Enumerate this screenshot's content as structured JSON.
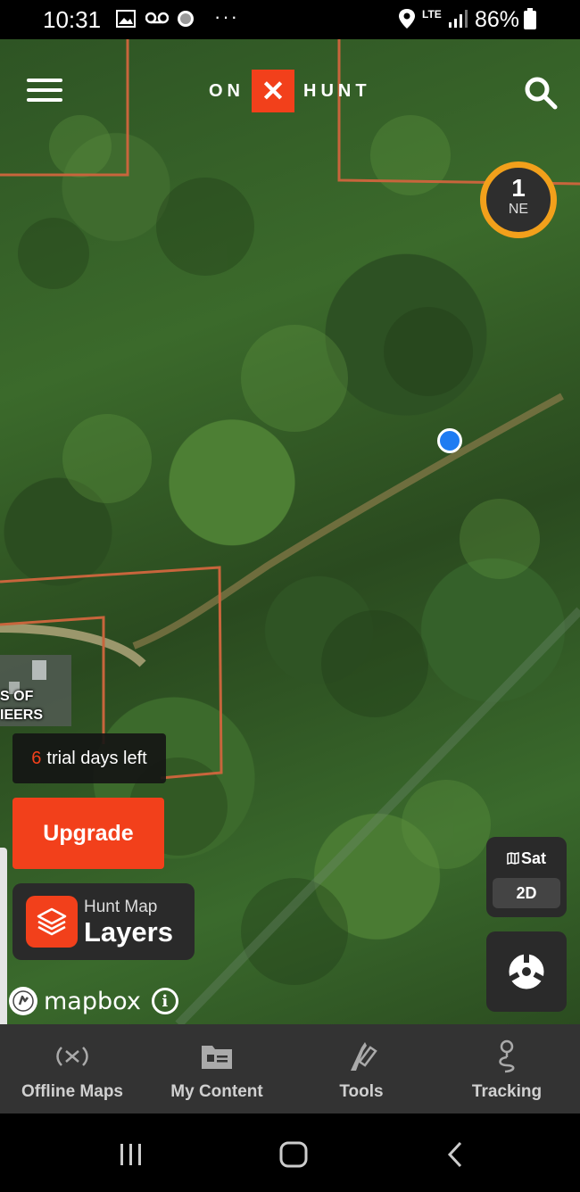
{
  "status_bar": {
    "time": "10:31",
    "network": "LTE",
    "battery": "86%",
    "icons": [
      "image-icon",
      "voicemail-icon",
      "chat-icon",
      "more-dots-icon",
      "location-icon",
      "signal-icon",
      "battery-icon"
    ]
  },
  "header": {
    "logo_left": "ON",
    "logo_mark": "✕",
    "logo_right": "HUNT",
    "menu_icon": "hamburger-icon",
    "search_icon": "search-icon"
  },
  "compass": {
    "count": "1",
    "direction": "NE"
  },
  "map": {
    "label_line1": "S OF",
    "label_line2": "IEERS"
  },
  "trial": {
    "days": "6",
    "text": "trial days left"
  },
  "upgrade": {
    "label": "Upgrade"
  },
  "layers": {
    "subtitle": "Hunt Map",
    "title": "Layers"
  },
  "attribution": {
    "brand": "mapbox",
    "info": "i"
  },
  "map_type": {
    "type": "Sat",
    "mode": "2D"
  },
  "bottom_nav": {
    "items": [
      {
        "label": "Offline Maps",
        "icon": "offline-signal-icon"
      },
      {
        "label": "My Content",
        "icon": "folder-icon"
      },
      {
        "label": "Tools",
        "icon": "tools-icon"
      },
      {
        "label": "Tracking",
        "icon": "tracking-pin-icon"
      }
    ]
  },
  "colors": {
    "brand_orange": "#f2401b",
    "compass_ring": "#f2a01b",
    "location_blue": "#1e7cf2",
    "parcel_line": "#c8653c",
    "nav_background": "#333333"
  }
}
